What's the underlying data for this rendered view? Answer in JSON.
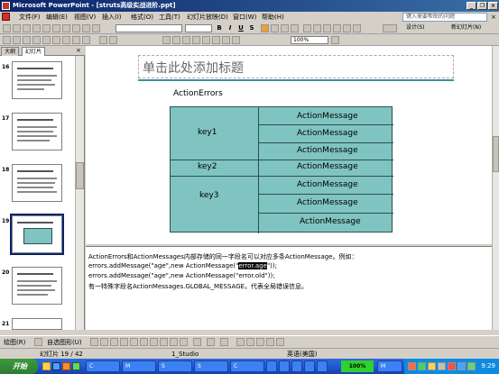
{
  "window": {
    "title": "Microsoft PowerPoint - [struts高级实战进阶.ppt]",
    "minimize": "_",
    "restore": "❐",
    "close": "×"
  },
  "menu": {
    "items": [
      "文件(F)",
      "编辑(E)",
      "视图(V)",
      "插入(I)",
      "格式(O)",
      "工具(T)",
      "幻灯片放映(D)",
      "窗口(W)",
      "帮助(H)"
    ],
    "help_placeholder": "键入需要帮助的问题",
    "help_close": "×"
  },
  "toolbar": {
    "font_name": "",
    "font_size": "",
    "zoom": "100%",
    "bold": "B",
    "italic": "I",
    "underline": "U",
    "shadow": "S",
    "design_label": "设计(S)",
    "new_slide_label": "新幻灯片(N)"
  },
  "outline_pane": {
    "tabs": [
      "大纲",
      "幻灯片"
    ],
    "close": "×",
    "slide_numbers": [
      "16",
      "17",
      "18",
      "19",
      "20",
      "21"
    ],
    "selected_index": 3
  },
  "slide": {
    "title_placeholder": "单击此处添加标题",
    "errors_label": "ActionErrors",
    "keys": [
      "key1",
      "key2",
      "key3"
    ],
    "messages": [
      "ActionMessage",
      "ActionMessage",
      "ActionMessage",
      "ActionMessage",
      "ActionMessage",
      "ActionMessage",
      "ActionMessage"
    ]
  },
  "notes": {
    "line1": "ActionErrors和ActionMessages内部存储的同一字段名可以对应多条ActionMessage。例如：",
    "line2_before": "errors.addMessage(\"age\",new ActionMessage(\"",
    "line2_highlight": "error.age",
    "line2_after": "\"));",
    "line3": "errors.addMessage(\"age\",new ActionMessage(\"error.old\"));",
    "line4": "有一特殊字段名ActionMessages.GLOBAL_MESSAGE，代表全局错误信息。"
  },
  "drawing_toolbar": {
    "draw_label": "绘图(R)",
    "autoshapes_label": "自选图形(U)"
  },
  "statusbar": {
    "slide_indicator": "幻灯片 19 / 42",
    "design": "1_Studio",
    "language": "英语(美国)"
  },
  "taskbar": {
    "start_label": "开始",
    "buttons": [
      "C",
      "M",
      "S",
      "S",
      "C",
      "",
      "",
      "",
      "",
      "",
      "M"
    ],
    "zoom_indicator": "100%",
    "clock": "9:29"
  }
}
